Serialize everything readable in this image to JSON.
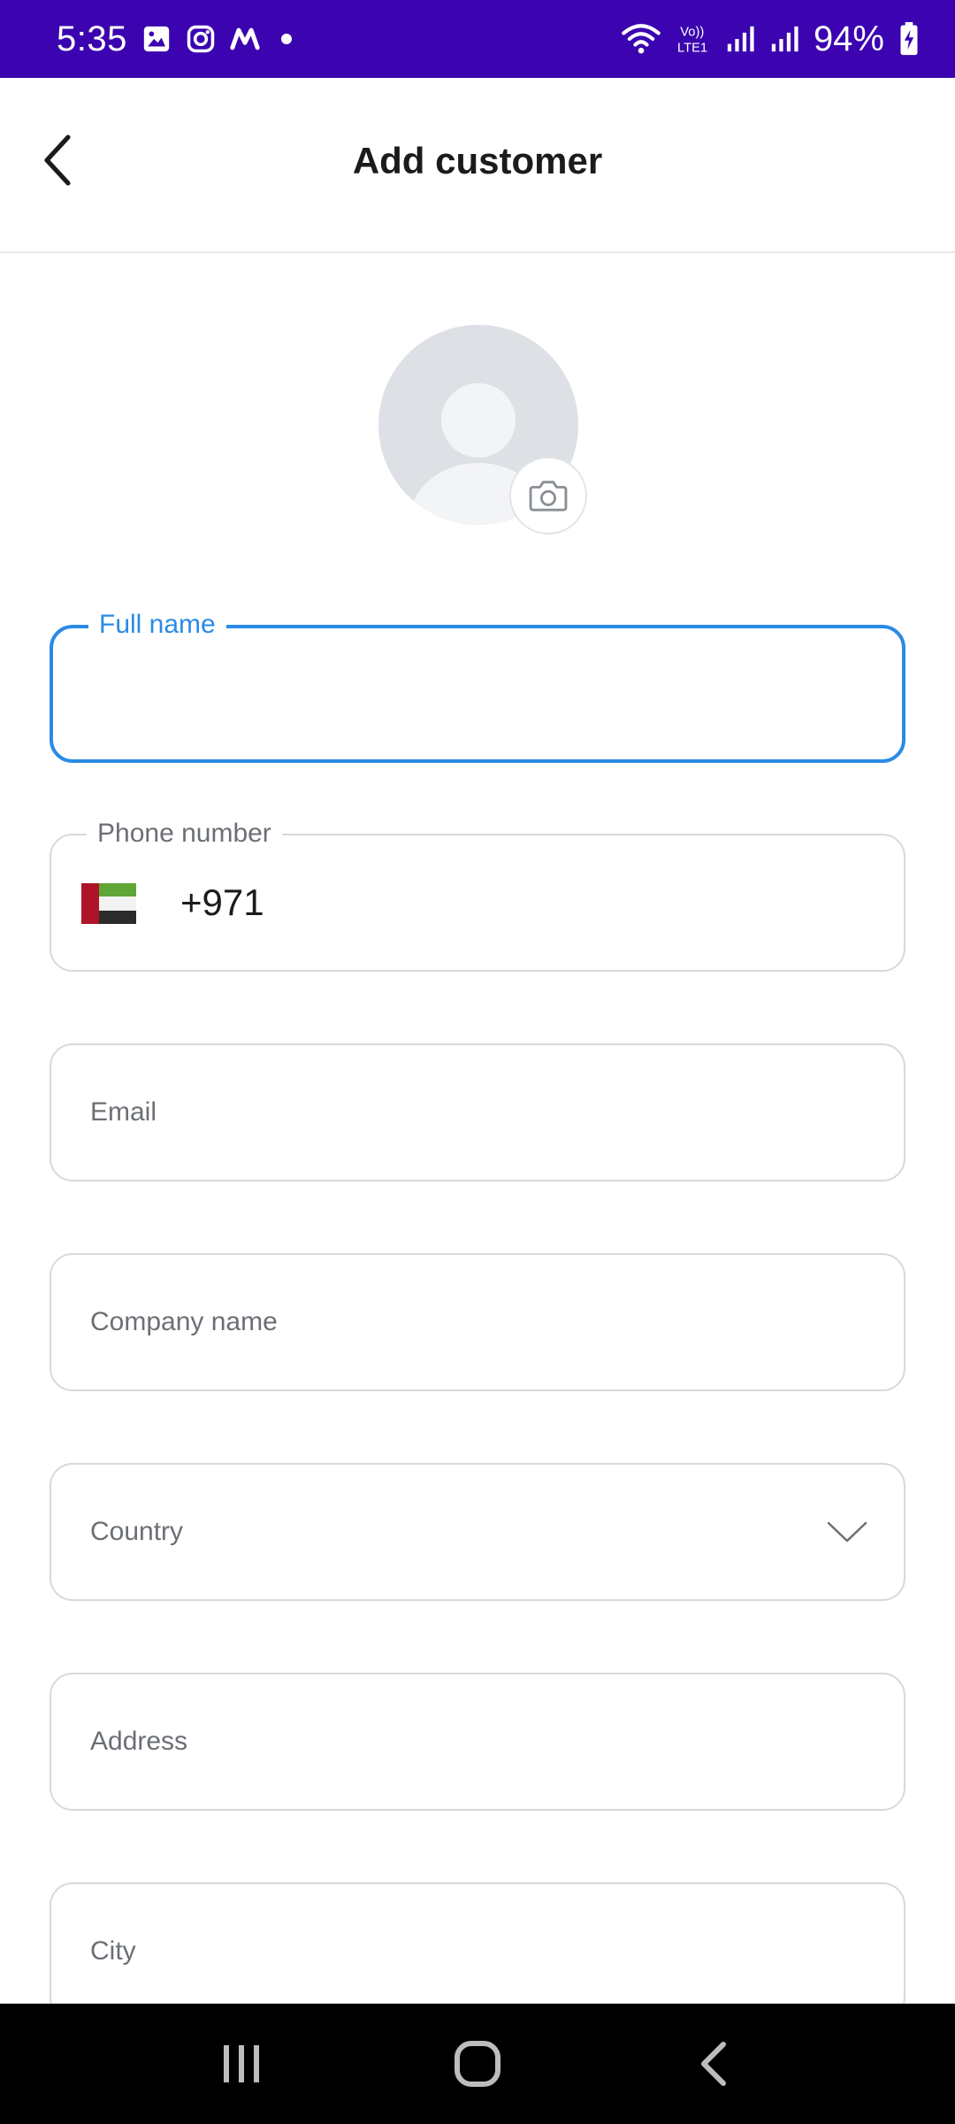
{
  "status_bar": {
    "time": "5:35",
    "battery_percent": "94%",
    "left_icons": [
      "gallery-icon",
      "instagram-icon",
      "m-app-icon",
      "dot-icon"
    ],
    "right_icons": [
      "wifi-icon",
      "volte-icon",
      "signal-icon",
      "signal-icon",
      "battery-charging-icon"
    ],
    "background_color": "#3b04b0"
  },
  "header": {
    "title": "Add customer",
    "back_icon": "chevron-left-icon"
  },
  "avatar": {
    "placeholder_icon": "user-silhouette-icon",
    "camera_icon": "camera-icon"
  },
  "form": {
    "full_name": {
      "label": "Full name",
      "value": "",
      "focused": true
    },
    "phone": {
      "label": "Phone number",
      "value": "+971",
      "flag": "uae-flag-icon"
    },
    "email": {
      "placeholder": "Email"
    },
    "company": {
      "placeholder": "Company name"
    },
    "country": {
      "placeholder": "Country",
      "icon": "chevron-down-icon"
    },
    "address": {
      "placeholder": "Address"
    },
    "city": {
      "placeholder": "City"
    }
  },
  "colors": {
    "accent": "#2a8be6",
    "border": "#d7d9dc",
    "muted_text": "#6b6f75"
  },
  "nav_bar": {
    "buttons": [
      "recents-icon",
      "home-icon",
      "back-icon"
    ]
  }
}
